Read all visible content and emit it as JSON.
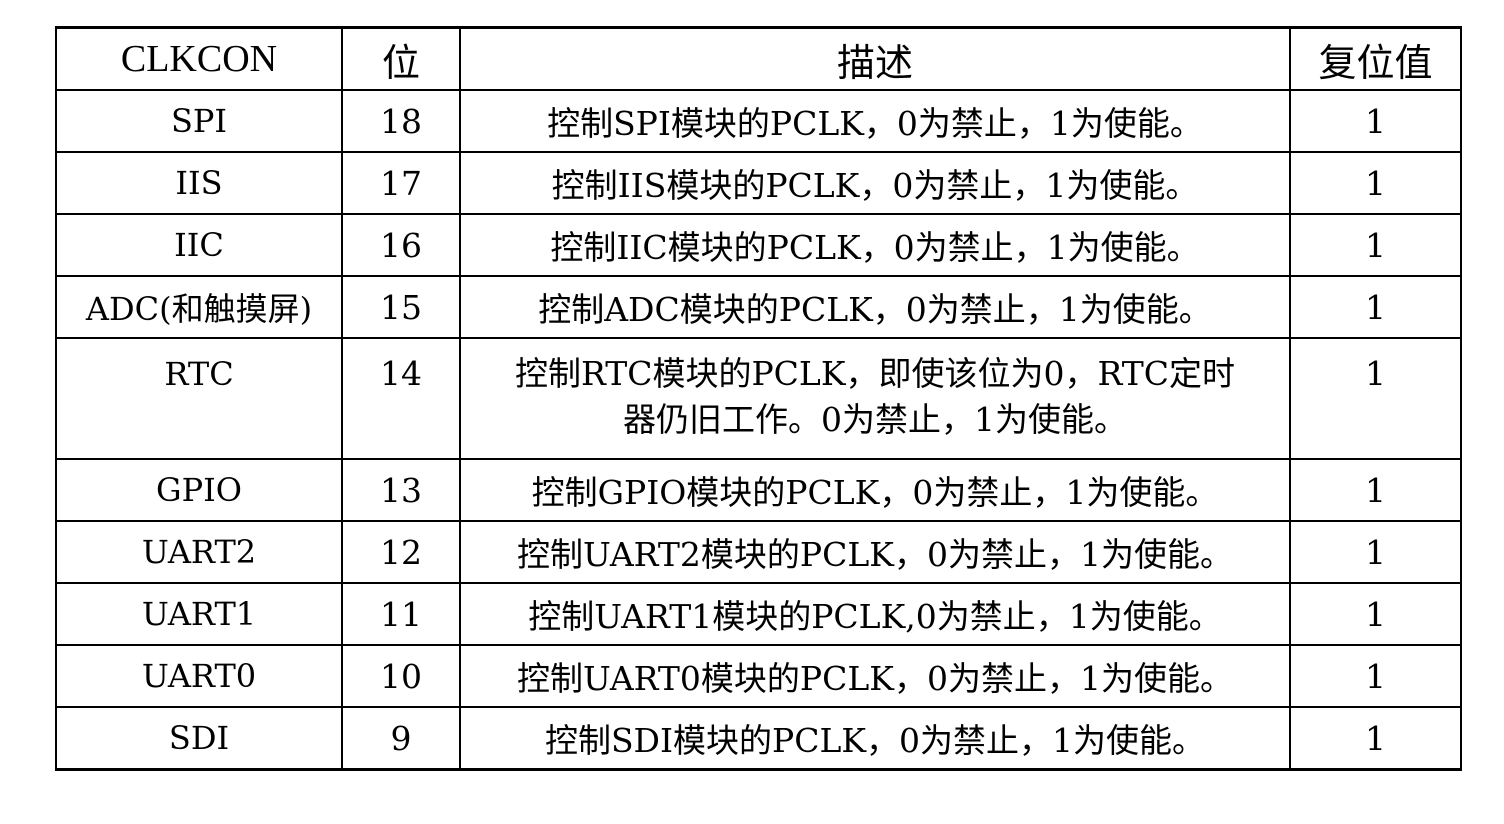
{
  "table": {
    "headers": [
      "CLKCON",
      "位",
      "描述",
      "复位值"
    ],
    "rows": [
      {
        "name": "SPI",
        "bit": "18",
        "desc": [
          "控制SPI模块的PCLK，0为禁止，1为使能。"
        ],
        "reset": "1"
      },
      {
        "name": "IIS",
        "bit": "17",
        "desc": [
          "控制IIS模块的PCLK，0为禁止，1为使能。"
        ],
        "reset": "1"
      },
      {
        "name": "IIC",
        "bit": "16",
        "desc": [
          "控制IIC模块的PCLK，0为禁止，1为使能。"
        ],
        "reset": "1"
      },
      {
        "name": "ADC(和触摸屏)",
        "bit": "15",
        "desc": [
          "控制ADC模块的PCLK，0为禁止，1为使能。"
        ],
        "reset": "1"
      },
      {
        "name": "RTC",
        "bit": "14",
        "desc": [
          "控制RTC模块的PCLK，即使该位为0，RTC定时",
          "器仍旧工作。0为禁止，1为使能。"
        ],
        "reset": "1"
      },
      {
        "name": "GPIO",
        "bit": "13",
        "desc": [
          "控制GPIO模块的PCLK，0为禁止，1为使能。"
        ],
        "reset": "1"
      },
      {
        "name": "UART2",
        "bit": "12",
        "desc": [
          "控制UART2模块的PCLK，0为禁止，1为使能。"
        ],
        "reset": "1"
      },
      {
        "name": "UART1",
        "bit": "11",
        "desc": [
          "控制UART1模块的PCLK,0为禁止，1为使能。"
        ],
        "reset": "1"
      },
      {
        "name": "UART0",
        "bit": "10",
        "desc": [
          "控制UART0模块的PCLK，0为禁止，1为使能。"
        ],
        "reset": "1"
      },
      {
        "name": "SDI",
        "bit": "9",
        "desc": [
          "控制SDI模块的PCLK，0为禁止，1为使能。"
        ],
        "reset": "1"
      }
    ]
  }
}
